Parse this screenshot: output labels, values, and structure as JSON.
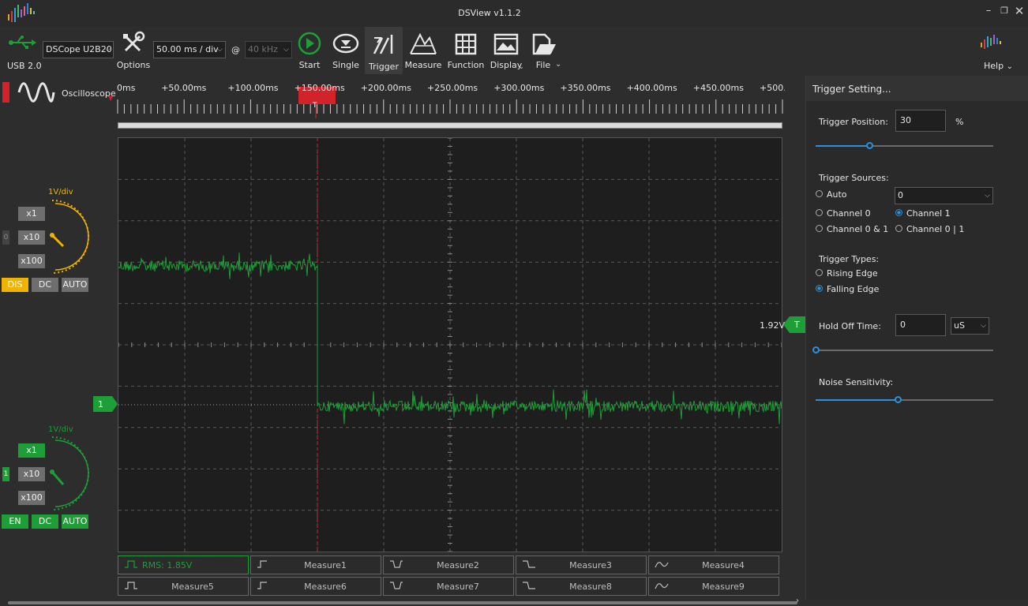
{
  "window": {
    "title": "DSView v1.1.2"
  },
  "toolbar": {
    "usb_label": "USB 2.0",
    "device": "DSCope U2B20",
    "options_label": "Options",
    "timebase": "50.00 ms / div",
    "at": "@",
    "samplerate": "40 kHz",
    "start": "Start",
    "single": "Single",
    "trigger": "Trigger",
    "measure": "Measure",
    "function": "Function",
    "display": "Display",
    "file": "File",
    "help": "Help"
  },
  "mode": {
    "label": "Oscilloscope"
  },
  "ruler": {
    "labels": [
      "0ms",
      "+50.00ms",
      "+100.00ms",
      "+150.00ms",
      "+200.00ms",
      "+250.00ms",
      "+300.00ms",
      "+350.00ms",
      "+400.00ms",
      "+450.00ms",
      "+500."
    ]
  },
  "channels": [
    {
      "index": "0",
      "vdiv": "1V/div",
      "x1": "x1",
      "x10": "x10",
      "x100": "x100",
      "enable": "DIS",
      "coupling": "DC",
      "auto": "AUTO",
      "color": "#f0b400"
    },
    {
      "index": "1",
      "vdiv": "1V/div",
      "x1": "x1",
      "x10": "x10",
      "x100": "x100",
      "enable": "EN",
      "coupling": "DC",
      "auto": "AUTO",
      "color": "#1e9e37"
    }
  ],
  "screen": {
    "channel_marker": "1",
    "trigger_level": "1.92V",
    "trigger_marker": "T",
    "trigger_pos_marker": "T"
  },
  "measures": [
    [
      "RMS: 1.85V",
      "Measure1",
      "Measure2",
      "Measure3",
      "Measure4"
    ],
    [
      "Measure5",
      "Measure6",
      "Measure7",
      "Measure8",
      "Measure9"
    ]
  ],
  "trigger_panel": {
    "header": "Trigger Setting...",
    "position_label": "Trigger Position:",
    "position_value": "30",
    "position_unit": "%",
    "position_fraction": 0.3,
    "sources_label": "Trigger Sources:",
    "src_auto": "Auto",
    "src_ch0": "Channel 0",
    "src_ch01": "Channel 0 & 1",
    "src_ch1": "Channel 1",
    "src_ch0or1": "Channel 0 | 1",
    "src_combo": "0",
    "types_label": "Trigger Types:",
    "type_rising": "Rising Edge",
    "type_falling": "Falling Edge",
    "holdoff_label": "Hold Off Time:",
    "holdoff_value": "0",
    "holdoff_unit": "uS",
    "holdoff_fraction": 0.0,
    "noise_label": "Noise Sensitivity:",
    "noise_fraction": 0.46
  }
}
